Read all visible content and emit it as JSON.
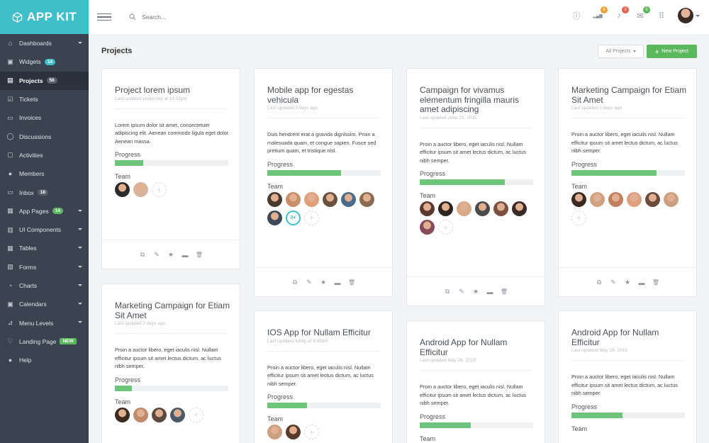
{
  "app": {
    "brand": "APP KIT"
  },
  "sidebar": {
    "items": [
      {
        "label": "Dashboards",
        "icon": "home-icon",
        "caret": true
      },
      {
        "label": "Widgets",
        "icon": "widgets-icon",
        "badge": "14",
        "badge_color": "#3fbfc9"
      },
      {
        "label": "Projects",
        "icon": "briefcase-icon",
        "badge": "56",
        "badge_color": "#59606c",
        "active": true
      },
      {
        "label": "Tickets",
        "icon": "ticket-icon"
      },
      {
        "label": "Invoices",
        "icon": "invoice-icon"
      },
      {
        "label": "Discussions",
        "icon": "chat-icon"
      },
      {
        "label": "Activities",
        "icon": "activity-icon"
      },
      {
        "label": "Members",
        "icon": "users-icon"
      },
      {
        "label": "Inbox",
        "icon": "inbox-icon",
        "badge": "18",
        "badge_color": "#59606c"
      },
      {
        "label": "App Pages",
        "icon": "pages-icon",
        "badge": "14",
        "badge_color": "#5cb85c",
        "caret": true
      },
      {
        "label": "UI Components",
        "icon": "components-icon",
        "caret": true
      },
      {
        "label": "Tables",
        "icon": "table-icon",
        "caret": true
      },
      {
        "label": "Forms",
        "icon": "form-icon",
        "caret": true
      },
      {
        "label": "Charts",
        "icon": "pie-chart-icon",
        "caret": true
      },
      {
        "label": "Calendars",
        "icon": "calendar-icon",
        "caret": true
      },
      {
        "label": "Menu Levels",
        "icon": "menu-levels-icon",
        "caret": true
      },
      {
        "label": "Landing Page",
        "icon": "heart-icon",
        "badge": "NEW",
        "badge_color": "#5cb85c"
      },
      {
        "label": "Help",
        "icon": "help-icon"
      }
    ]
  },
  "topbar": {
    "search_placeholder": "Search...",
    "notifications": [
      {
        "icon": "info-icon",
        "count": ""
      },
      {
        "icon": "signal-icon",
        "count": "8",
        "color": "#f0a030"
      },
      {
        "icon": "bell-icon",
        "count": "3",
        "color": "#e8604c"
      },
      {
        "icon": "mail-icon",
        "count": "5",
        "color": "#5cb85c"
      },
      {
        "icon": "apps-grid-icon",
        "count": ""
      }
    ]
  },
  "page": {
    "title": "Projects",
    "filter_label": "All Projects",
    "new_label": "New Project"
  },
  "labels": {
    "progress": "Progress",
    "team": "Team"
  },
  "cards": [
    {
      "title": "Project lorem ipsum",
      "updated": "Last updated yesterday at 14:02pm",
      "desc": "Lorem ipsum dolor sit amet, consectetuer adipiscing elit. Aenean commodo ligula eget dolor. Aenean massa.",
      "progress": 0.25,
      "team": [
        "#2b2b2b",
        "#d8b49c"
      ],
      "more": ""
    },
    {
      "title": "Mobile app for egestas vehicula",
      "updated": "Last updated 3 days ago",
      "desc": "Duis hendrerit erat a gravida dignissim. Proin a malesuada quam, et congue sapien. Fusce sed pretium quam, et tristique nisl.",
      "progress": 0.65,
      "team": [
        "#4a3a2e",
        "#c98d6a",
        "#e2a07a",
        "#6a5040",
        "#4a6a8a",
        "#8a6a50",
        "#3c4a58"
      ],
      "more": "3+"
    },
    {
      "title": "Campaign for vivamus elementum fringilla mauris amet adipiscing",
      "updated": "Last updated June 23, 2015",
      "desc": "Proin a auctor libero, eget iaculis nisl. Nullam efficitur ipsum sit amet lectus dictum, ac luctus nibh semper.",
      "progress": 0.75,
      "team": [
        "#5a3a30",
        "#2e2420",
        "#d8a888",
        "#4a4a4a",
        "#7a5040",
        "#3a2a2a",
        "#8a4a5a"
      ],
      "more": ""
    },
    {
      "title": "Marketing Campaign for Etiam Sit Amet",
      "updated": "Last updated 2 days ago",
      "desc": "Proin a auctor libero, eget iaculis nisl. Nullam efficitur ipsum sit amet lectus dictum, ac luctus nibh semper.",
      "progress": 0.75,
      "team": [
        "#3a2a20",
        "#d0a080",
        "#c08060",
        "#e0a080",
        "#6a4a3a",
        "#caa080"
      ],
      "more": ""
    },
    {
      "title": "Marketing Campaign for Etiam Sit Amet",
      "updated": "Last updated 2 days ago",
      "desc": "Proin a auctor libero, eget iaculis nisl. Nullam efficitur ipsum sit amet lectus dictum, ac luctus nibh semper.",
      "progress": 0.15,
      "team": [
        "#3a2a20",
        "#c08a6a",
        "#5a4a40",
        "#4a5a6a"
      ],
      "more": ""
    },
    {
      "title": "IOS App for Nullam Efficitur",
      "updated": "Last updated today at 8:45am",
      "desc": "Proin a auctor libero, eget iaculis nisl. Nullam efficitur ipsum sit amet lectus dictum, ac luctus nibh semper.",
      "progress": 0.35,
      "team": [
        "#caa080",
        "#5a3a2a"
      ],
      "more": ""
    },
    {
      "title": "Android App for Nullam Efficitur",
      "updated": "Last updated May 26, 2015",
      "desc": "Proin a auctor libero, eget iaculis nisl. Nullam efficitur ipsum sit amet lectus dictum, ac luctus nibh semper.",
      "progress": 0.45,
      "team": [],
      "more": ""
    },
    {
      "title": "Android App for Nullam Efficitur",
      "updated": "Last updated May 26, 2015",
      "desc": "Proin a auctor libero, eget iaculis nisl. Nullam efficitur ipsum sit amet lectus dictum, ac luctus nibh semper.",
      "progress": 0.45,
      "team": [],
      "more": ""
    }
  ]
}
